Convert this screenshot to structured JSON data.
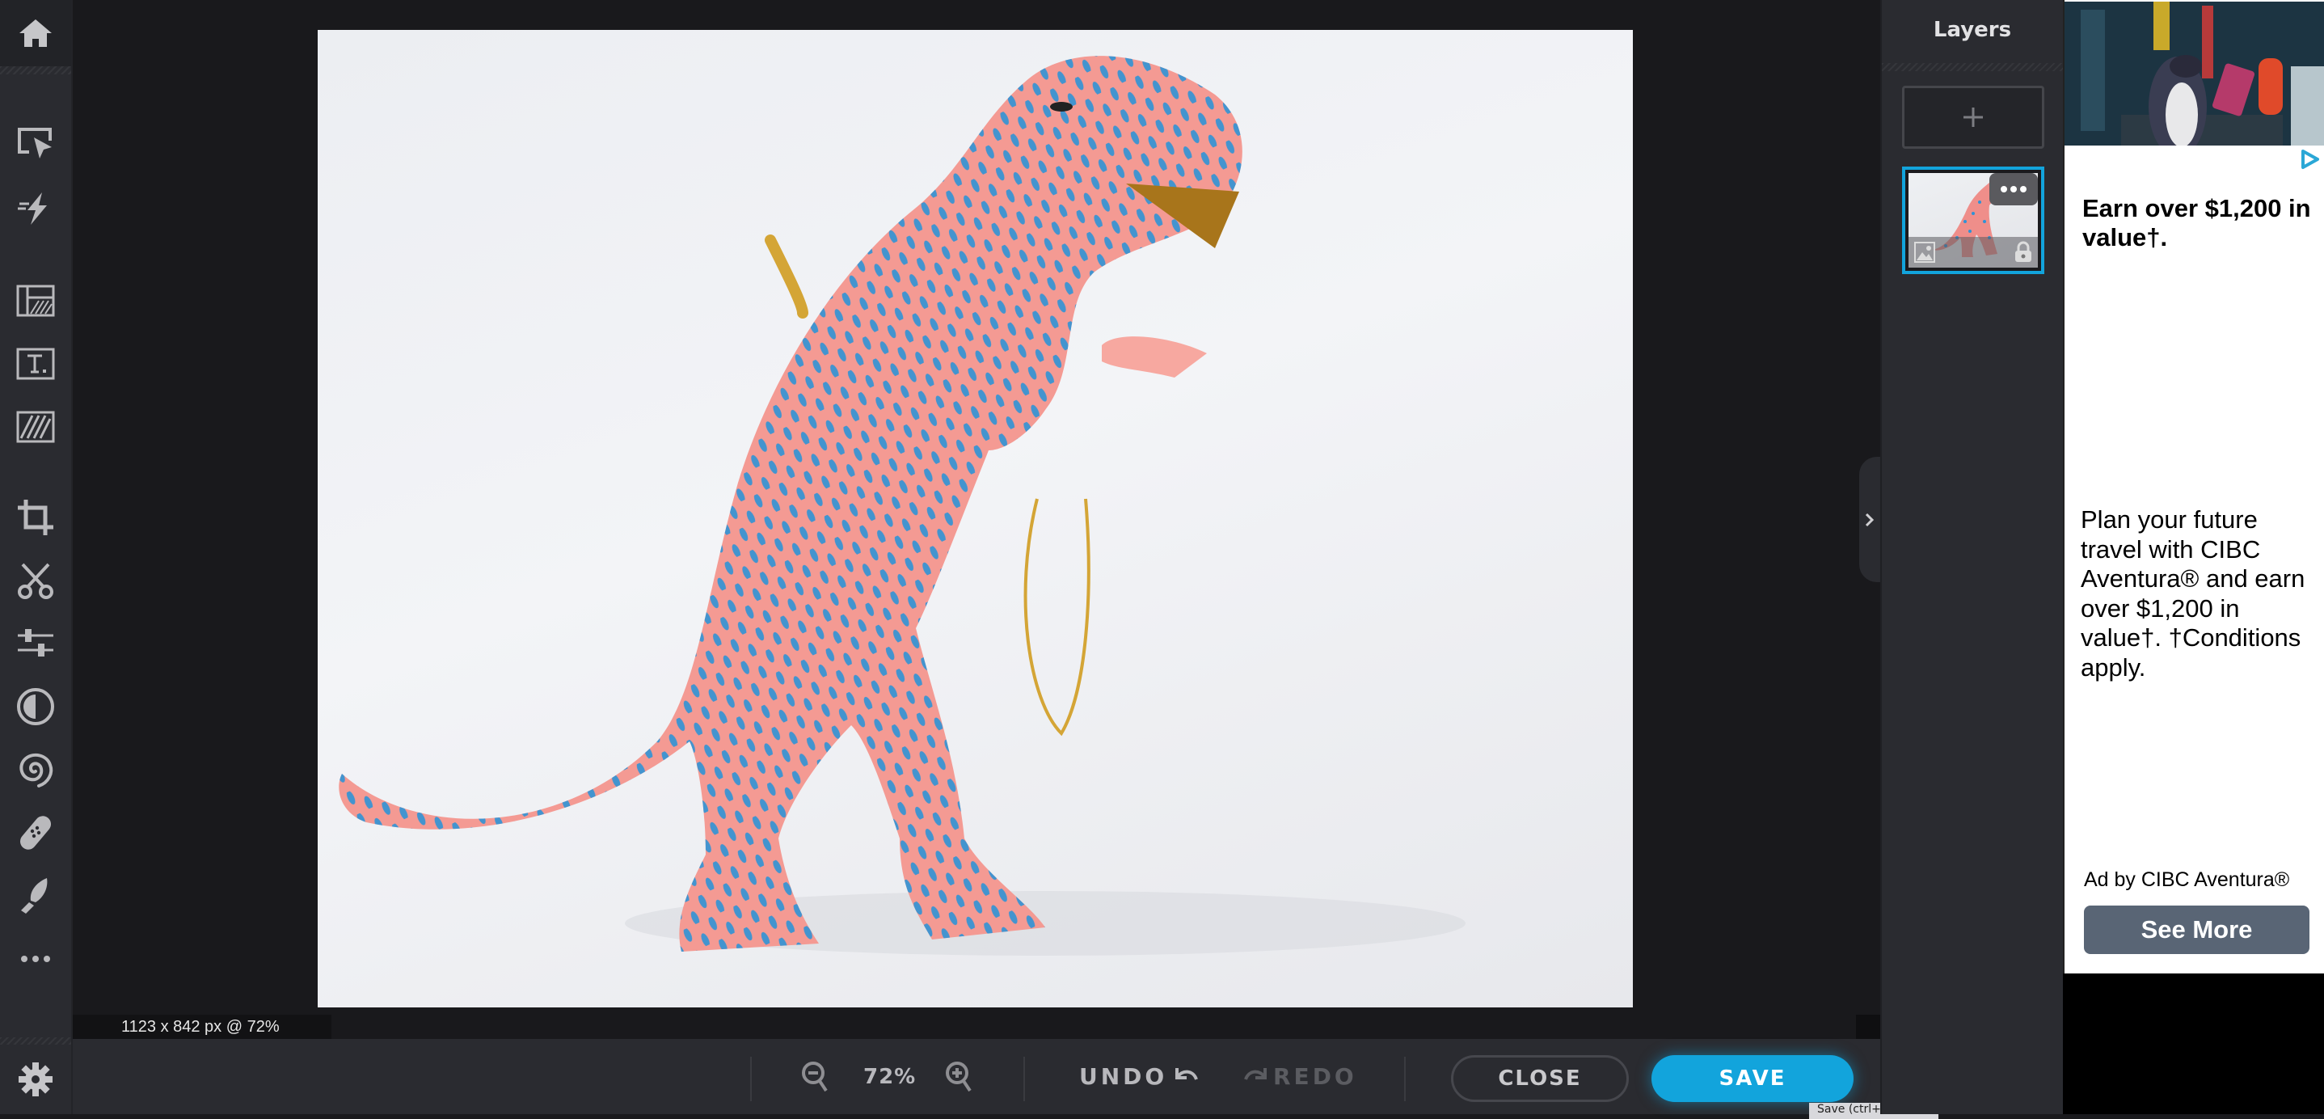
{
  "sidebar": {
    "tools": [
      {
        "name": "home",
        "icon": "home-icon"
      },
      {
        "name": "select",
        "icon": "select-cursor-icon"
      },
      {
        "name": "quick-fix",
        "icon": "lightning-icon"
      },
      {
        "name": "layout",
        "icon": "layout-icon"
      },
      {
        "name": "text",
        "icon": "text-icon"
      },
      {
        "name": "texture",
        "icon": "texture-icon"
      },
      {
        "name": "crop",
        "icon": "crop-icon"
      },
      {
        "name": "cutout",
        "icon": "scissors-icon"
      },
      {
        "name": "adjust",
        "icon": "sliders-icon"
      },
      {
        "name": "effects",
        "icon": "contrast-icon"
      },
      {
        "name": "distort",
        "icon": "spiral-icon"
      },
      {
        "name": "retouch",
        "icon": "bandage-icon"
      },
      {
        "name": "draw",
        "icon": "brush-icon"
      },
      {
        "name": "more",
        "icon": "more-icon"
      },
      {
        "name": "settings",
        "icon": "gear-icon"
      }
    ]
  },
  "canvas": {
    "image_description": "Pink papier-mache T-rex with blue spots on white background",
    "status": "1123 x 842 px @ 72%"
  },
  "toolbar": {
    "zoom_value": "72%",
    "undo_label": "UNDO",
    "redo_label": "REDO",
    "close_label": "CLOSE",
    "save_label": "SAVE",
    "tooltip": "Save (ctrl+s)"
  },
  "layers": {
    "title": "Layers",
    "add_label": "+",
    "items": [
      {
        "type": "image",
        "locked": true,
        "selected": true
      }
    ]
  },
  "ad": {
    "headline": "Earn over $1,200 in value†.",
    "body": "Plan your future travel with CIBC Aventura® and earn over $1,200 in value†. †Conditions apply.",
    "advertiser": "Ad by CIBC Aventura®",
    "cta": "See More"
  },
  "colors": {
    "accent": "#12a4dc",
    "panel": "#2a2b30",
    "canvas_bg": "#19191c",
    "cta_bg": "#596575"
  }
}
